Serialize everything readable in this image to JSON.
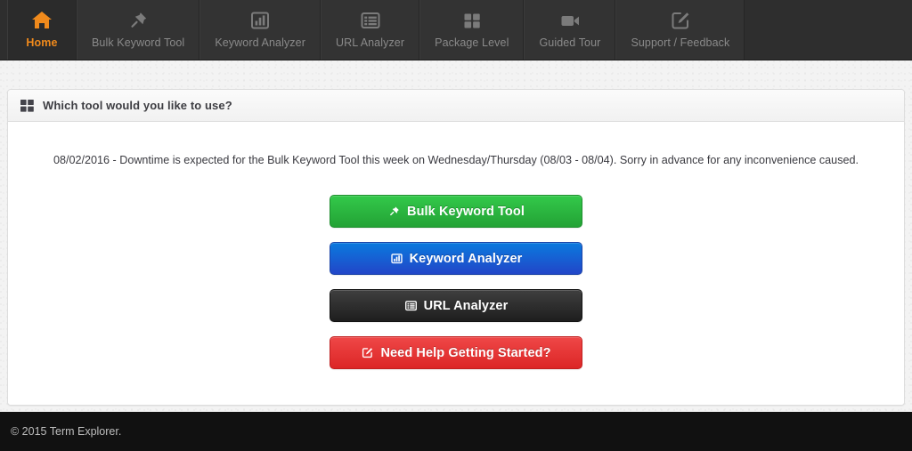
{
  "nav": {
    "items": [
      {
        "label": "Home",
        "icon": "home-icon",
        "active": true
      },
      {
        "label": "Bulk Keyword Tool",
        "icon": "pushpin-icon",
        "active": false
      },
      {
        "label": "Keyword Analyzer",
        "icon": "bar-chart-icon",
        "active": false
      },
      {
        "label": "URL Analyzer",
        "icon": "list-table-icon",
        "active": false
      },
      {
        "label": "Package Level",
        "icon": "grid-squares-icon",
        "active": false
      },
      {
        "label": "Guided Tour",
        "icon": "video-camera-icon",
        "active": false
      },
      {
        "label": "Support / Feedback",
        "icon": "edit-square-icon",
        "active": false
      }
    ],
    "active_color": "#f08a1c",
    "background": "#2e2e2e"
  },
  "panel": {
    "heading_icon": "th-large-icon",
    "title": "Which tool would you like to use?",
    "notice": "08/02/2016 - Downtime is expected for the Bulk Keyword Tool this week on Wednesday/Thursday (08/03 - 08/04). Sorry in advance for any inconvenience caused.",
    "buttons": [
      {
        "label": "Bulk Keyword Tool",
        "icon": "pushpin-icon",
        "color": "#23a235"
      },
      {
        "label": "Keyword Analyzer",
        "icon": "bar-chart-icon",
        "color": "#2246c8"
      },
      {
        "label": "URL Analyzer",
        "icon": "list-table-icon",
        "color": "#1e1e1e"
      },
      {
        "label": "Need Help Getting Started?",
        "icon": "edit-square-icon",
        "color": "#dc2626"
      }
    ]
  },
  "footer": {
    "copyright": "© 2015 Term Explorer."
  }
}
